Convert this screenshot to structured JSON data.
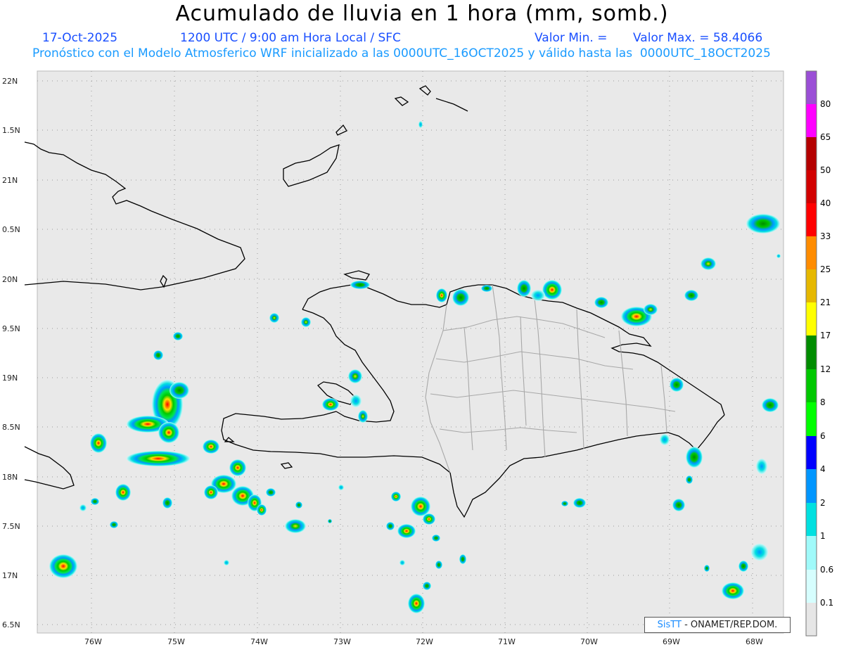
{
  "header": {
    "title": "Acumulado de lluvia en 1 hora (mm, somb.)",
    "date": "17-Oct-2025",
    "time": "1200 UTC / 9:00 am Hora Local / SFC",
    "min_label": "Valor Min. =",
    "max_label": "Valor Max. = 58.4066",
    "model_line": "Pronóstico con el Modelo Atmosferico WRF inicializado a las 0000UTC_16OCT2025 y válido hasta las  0000UTC_18OCT2025"
  },
  "map": {
    "lat_labels": [
      "22N",
      "1.5N",
      "21N",
      "0.5N",
      "20N",
      "9.5N",
      "19N",
      "8.5N",
      "18N",
      "7.5N",
      "17N",
      "6.5N"
    ],
    "lon_labels": [
      "76W",
      "75W",
      "74W",
      "73W",
      "72W",
      "71W",
      "70W",
      "69W",
      "68W"
    ],
    "background": "#e9e9e9"
  },
  "colorbar": {
    "labels": [
      "0.1",
      "0.6",
      "1",
      "2",
      "4",
      "6",
      "8",
      "12",
      "17",
      "21",
      "25",
      "33",
      "40",
      "50",
      "65",
      "80"
    ],
    "colors": [
      "#e6e6e6",
      "#d6fefe",
      "#a0fafa",
      "#00e0e0",
      "#0096ff",
      "#0000ff",
      "#00ff00",
      "#00c800",
      "#008c00",
      "#ffff00",
      "#ffe000",
      "#e6b800",
      "#ff8c00",
      "#ff0000",
      "#d20000",
      "#b40000",
      "#ff00ff",
      "#9b4fd6"
    ]
  },
  "credit": {
    "brand": "SisTT",
    "text": "- ONAMET/REP.DOM."
  }
}
